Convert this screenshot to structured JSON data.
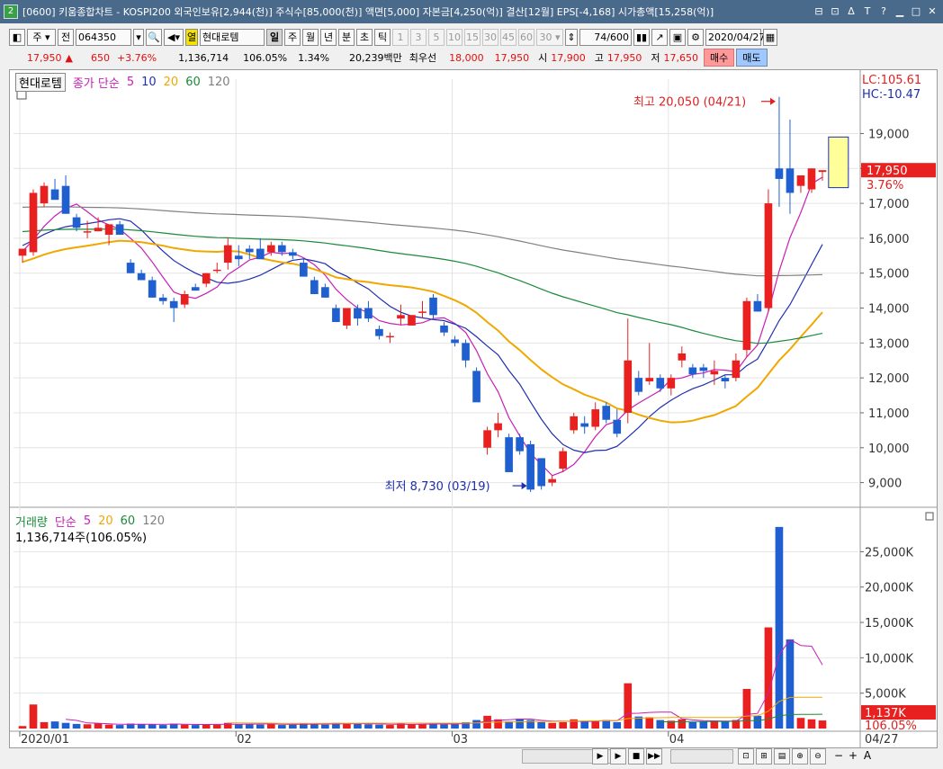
{
  "window": {
    "number": "2",
    "title": "[0600] 키움종합차트 - KOSPI200 외국인보유[2,944(천)] 주식수[85,000(천)] 액면[5,000] 자본금[4,250(억)] 결산[12월] EPS[-4,168] 시가총액[15,258(억)]"
  },
  "toolbar": {
    "period_label": "주",
    "prev_label": "전",
    "code": "064350",
    "stock_name": "현대로템",
    "yellow_tag": "열",
    "intervals": [
      "일",
      "주",
      "월",
      "년",
      "분",
      "초",
      "틱"
    ],
    "minute_steps": [
      "1",
      "3",
      "5",
      "10",
      "15",
      "30",
      "45",
      "60"
    ],
    "step_value": "30",
    "count": "74",
    "count_max": "/600",
    "date": "2020/04/27"
  },
  "quote": {
    "price": "17,950",
    "arrow": "▲",
    "change": "650",
    "change_pct": "+3.76%",
    "volume": "1,136,714",
    "volume_ratio": "106.05%",
    "turnover": "1.34%",
    "amount": "20,239백만",
    "best_bid_label": "최우선",
    "best_bid": "18,000",
    "best_ask": "17,950",
    "open_label": "시",
    "open": "17,900",
    "high_label": "고",
    "high": "17,950",
    "low_label": "저",
    "low": "17,650",
    "buy_label": "매수",
    "sell_label": "매도"
  },
  "price_panel": {
    "stock_label": "현대로템",
    "ma_label": "종가 단순",
    "ma_periods": [
      "5",
      "10",
      "20",
      "60",
      "120"
    ],
    "ma_colors": [
      "#c61fb5",
      "#1f2eb0",
      "#f0a800",
      "#1a8a3a",
      "#808080"
    ],
    "lc_label": "LC:105.61",
    "hc_label": "HC:-10.47",
    "high_annotation": "최고 20,050 (04/21)",
    "low_annotation": "최저 8,730 (03/19)",
    "current_price_tag": "17,950",
    "current_pct_tag": "3.76%",
    "y_ticks": [
      "19,000",
      "18,000",
      "17,000",
      "16,000",
      "15,000",
      "14,000",
      "13,000",
      "12,000",
      "11,000",
      "10,000",
      "9,000"
    ]
  },
  "volume_panel": {
    "label": "거래량",
    "ma_label": "단순",
    "ma_periods": [
      "5",
      "20",
      "60",
      "120"
    ],
    "info": "1,136,714주(106.05%)",
    "y_ticks": [
      "25,000K",
      "20,000K",
      "15,000K",
      "10,000K",
      "5,000K"
    ],
    "current_tag": "1,137K",
    "current_pct": "106.05%"
  },
  "x_axis": {
    "labels": [
      "2020/01",
      "02",
      "03",
      "04"
    ],
    "end_label": "04/27"
  },
  "chart_data": {
    "type": "candlestick",
    "ylim": [
      8500,
      20300
    ],
    "volume_ylim": [
      0,
      29500
    ],
    "candles": [
      {
        "o": 15500,
        "h": 15700,
        "l": 15300,
        "c": 15700
      },
      {
        "o": 15600,
        "h": 17400,
        "l": 15500,
        "c": 17300
      },
      {
        "o": 17000,
        "h": 17600,
        "l": 16900,
        "c": 17500
      },
      {
        "o": 17400,
        "h": 17700,
        "l": 17200,
        "c": 17100
      },
      {
        "o": 17500,
        "h": 17800,
        "l": 16700,
        "c": 16700
      },
      {
        "o": 16600,
        "h": 16700,
        "l": 16200,
        "c": 16300
      },
      {
        "o": 16200,
        "h": 16500,
        "l": 16000,
        "c": 16200
      },
      {
        "o": 16200,
        "h": 16600,
        "l": 16200,
        "c": 16300
      },
      {
        "o": 16100,
        "h": 16200,
        "l": 15800,
        "c": 16400
      },
      {
        "o": 16400,
        "h": 16500,
        "l": 16100,
        "c": 16100
      },
      {
        "o": 15300,
        "h": 15400,
        "l": 15000,
        "c": 15000
      },
      {
        "o": 15000,
        "h": 15100,
        "l": 14800,
        "c": 14800
      },
      {
        "o": 14800,
        "h": 14900,
        "l": 14300,
        "c": 14300
      },
      {
        "o": 14300,
        "h": 14400,
        "l": 14100,
        "c": 14200
      },
      {
        "o": 14200,
        "h": 14300,
        "l": 13600,
        "c": 14000
      },
      {
        "o": 14100,
        "h": 14500,
        "l": 14000,
        "c": 14400
      },
      {
        "o": 14600,
        "h": 14700,
        "l": 14500,
        "c": 14500
      },
      {
        "o": 14700,
        "h": 15000,
        "l": 14600,
        "c": 15000
      },
      {
        "o": 15100,
        "h": 15300,
        "l": 15000,
        "c": 15100
      },
      {
        "o": 15300,
        "h": 16000,
        "l": 15100,
        "c": 15800
      },
      {
        "o": 15500,
        "h": 15800,
        "l": 15200,
        "c": 15400
      },
      {
        "o": 15700,
        "h": 15800,
        "l": 15400,
        "c": 15600
      },
      {
        "o": 15700,
        "h": 16000,
        "l": 15400,
        "c": 15400
      },
      {
        "o": 15600,
        "h": 15900,
        "l": 15500,
        "c": 15800
      },
      {
        "o": 15800,
        "h": 15900,
        "l": 15500,
        "c": 15600
      },
      {
        "o": 15600,
        "h": 15700,
        "l": 15400,
        "c": 15500
      },
      {
        "o": 15300,
        "h": 15400,
        "l": 14900,
        "c": 14900
      },
      {
        "o": 14800,
        "h": 14900,
        "l": 14600,
        "c": 14400
      },
      {
        "o": 14600,
        "h": 14700,
        "l": 14300,
        "c": 14300
      },
      {
        "o": 14000,
        "h": 14100,
        "l": 13600,
        "c": 13600
      },
      {
        "o": 13500,
        "h": 14000,
        "l": 13400,
        "c": 14000
      },
      {
        "o": 14000,
        "h": 14100,
        "l": 13500,
        "c": 13700
      },
      {
        "o": 14000,
        "h": 14200,
        "l": 13600,
        "c": 13700
      },
      {
        "o": 13400,
        "h": 13500,
        "l": 13100,
        "c": 13200
      },
      {
        "o": 13200,
        "h": 13300,
        "l": 13000,
        "c": 13200
      },
      {
        "o": 13700,
        "h": 14100,
        "l": 13500,
        "c": 13800
      },
      {
        "o": 13500,
        "h": 13800,
        "l": 13500,
        "c": 13800
      },
      {
        "o": 13900,
        "h": 14200,
        "l": 13700,
        "c": 13900
      },
      {
        "o": 14300,
        "h": 14400,
        "l": 13700,
        "c": 13800
      },
      {
        "o": 13500,
        "h": 13600,
        "l": 13200,
        "c": 13300
      },
      {
        "o": 13100,
        "h": 13200,
        "l": 12900,
        "c": 13000
      },
      {
        "o": 13000,
        "h": 13100,
        "l": 12300,
        "c": 12500
      },
      {
        "o": 12200,
        "h": 12300,
        "l": 11400,
        "c": 11300
      },
      {
        "o": 10000,
        "h": 10600,
        "l": 9800,
        "c": 10500
      },
      {
        "o": 10500,
        "h": 11000,
        "l": 10300,
        "c": 10700
      },
      {
        "o": 10300,
        "h": 10400,
        "l": 9300,
        "c": 9300
      },
      {
        "o": 10300,
        "h": 10400,
        "l": 9800,
        "c": 9900
      },
      {
        "o": 10100,
        "h": 10200,
        "l": 8730,
        "c": 8800
      },
      {
        "o": 9700,
        "h": 9700,
        "l": 8800,
        "c": 8900
      },
      {
        "o": 9000,
        "h": 9200,
        "l": 8900,
        "c": 9100
      },
      {
        "o": 9400,
        "h": 10000,
        "l": 9300,
        "c": 9900
      },
      {
        "o": 10500,
        "h": 11000,
        "l": 10400,
        "c": 10900
      },
      {
        "o": 10700,
        "h": 10900,
        "l": 10400,
        "c": 10600
      },
      {
        "o": 10600,
        "h": 11300,
        "l": 10500,
        "c": 11100
      },
      {
        "o": 11200,
        "h": 11300,
        "l": 10700,
        "c": 10800
      },
      {
        "o": 10800,
        "h": 11100,
        "l": 10300,
        "c": 10400
      },
      {
        "o": 11000,
        "h": 13700,
        "l": 10700,
        "c": 12500
      },
      {
        "o": 12000,
        "h": 12200,
        "l": 11500,
        "c": 11600
      },
      {
        "o": 11900,
        "h": 13000,
        "l": 11800,
        "c": 12000
      },
      {
        "o": 12000,
        "h": 12100,
        "l": 11600,
        "c": 11700
      },
      {
        "o": 11700,
        "h": 12100,
        "l": 11500,
        "c": 12000
      },
      {
        "o": 12500,
        "h": 12900,
        "l": 12300,
        "c": 12700
      },
      {
        "o": 12300,
        "h": 12400,
        "l": 12000,
        "c": 12100
      },
      {
        "o": 12300,
        "h": 12400,
        "l": 12000,
        "c": 12200
      },
      {
        "o": 12100,
        "h": 12500,
        "l": 11800,
        "c": 12200
      },
      {
        "o": 12000,
        "h": 12100,
        "l": 11700,
        "c": 11900
      },
      {
        "o": 12000,
        "h": 12700,
        "l": 11900,
        "c": 12500
      },
      {
        "o": 12800,
        "h": 14300,
        "l": 12600,
        "c": 14200
      },
      {
        "o": 14200,
        "h": 14400,
        "l": 13900,
        "c": 13900
      },
      {
        "o": 14000,
        "h": 17400,
        "l": 13900,
        "c": 17000
      },
      {
        "o": 18000,
        "h": 20050,
        "l": 16900,
        "c": 17700
      },
      {
        "o": 18000,
        "h": 19400,
        "l": 16700,
        "c": 17300
      },
      {
        "o": 17500,
        "h": 17800,
        "l": 17300,
        "c": 17800
      },
      {
        "o": 17400,
        "h": 18000,
        "l": 17300,
        "c": 18000
      },
      {
        "o": 17900,
        "h": 17950,
        "l": 17650,
        "c": 17950
      }
    ],
    "volume": [
      350,
      3400,
      900,
      1000,
      800,
      650,
      600,
      700,
      550,
      500,
      700,
      650,
      600,
      500,
      700,
      550,
      500,
      600,
      550,
      800,
      600,
      650,
      550,
      700,
      500,
      550,
      700,
      650,
      550,
      800,
      700,
      650,
      600,
      550,
      500,
      700,
      600,
      650,
      700,
      600,
      650,
      900,
      1200,
      1800,
      1300,
      1000,
      1400,
      1200,
      900,
      800,
      900,
      1300,
      1100,
      1000,
      1200,
      900,
      6400,
      1700,
      1600,
      1200,
      1100,
      1300,
      900,
      1000,
      1100,
      1000,
      1200,
      5600,
      1800,
      14300,
      28500,
      12600,
      1500,
      1300,
      1137
    ],
    "volume_ma5": [
      null,
      null,
      null,
      null,
      1300,
      1150,
      790,
      750,
      660,
      600,
      600,
      600,
      600,
      590,
      630,
      610,
      570,
      570,
      580,
      600,
      610,
      620,
      640,
      660,
      600,
      600,
      600,
      620,
      630,
      650,
      680,
      700,
      660,
      660,
      600,
      600,
      590,
      600,
      630,
      650,
      640,
      700,
      810,
      1030,
      1170,
      1240,
      1340,
      1340,
      1160,
      1060,
      1040,
      1020,
      1000,
      1020,
      1100,
      1100,
      2120,
      2160,
      2280,
      2320,
      2320,
      1380,
      1220,
      1120,
      1080,
      1060,
      1040,
      1980,
      2140,
      4980,
      10440,
      12560,
      11740,
      11640,
      9007
    ],
    "volume_ma20": [
      null,
      null,
      null,
      null,
      null,
      null,
      null,
      null,
      null,
      null,
      null,
      null,
      null,
      null,
      null,
      null,
      null,
      null,
      null,
      800,
      800,
      780,
      770,
      760,
      740,
      730,
      740,
      740,
      740,
      750,
      750,
      750,
      760,
      760,
      750,
      760,
      760,
      760,
      760,
      760,
      760,
      770,
      800,
      860,
      900,
      920,
      960,
      990,
      1000,
      1010,
      1020,
      1050,
      1070,
      1090,
      1120,
      1130,
      1410,
      1460,
      1510,
      1530,
      1560,
      1580,
      1570,
      1560,
      1560,
      1570,
      1560,
      1770,
      1810,
      2460,
      3830,
      4400,
      4410,
      4410,
      4420
    ],
    "volume_ma60": [
      null,
      null,
      null,
      null,
      null,
      null,
      null,
      null,
      null,
      null,
      null,
      null,
      null,
      null,
      null,
      null,
      null,
      null,
      null,
      null,
      null,
      null,
      null,
      null,
      null,
      null,
      null,
      null,
      null,
      null,
      null,
      null,
      null,
      null,
      null,
      null,
      null,
      null,
      null,
      null,
      null,
      null,
      null,
      null,
      null,
      null,
      null,
      null,
      null,
      null,
      null,
      null,
      null,
      null,
      null,
      null,
      null,
      null,
      null,
      950,
      960,
      970,
      980,
      990,
      1000,
      1010,
      1020,
      1100,
      1120,
      1330,
      1790,
      1980,
      2000,
      2010,
      2020
    ],
    "volume_ma120": []
  }
}
